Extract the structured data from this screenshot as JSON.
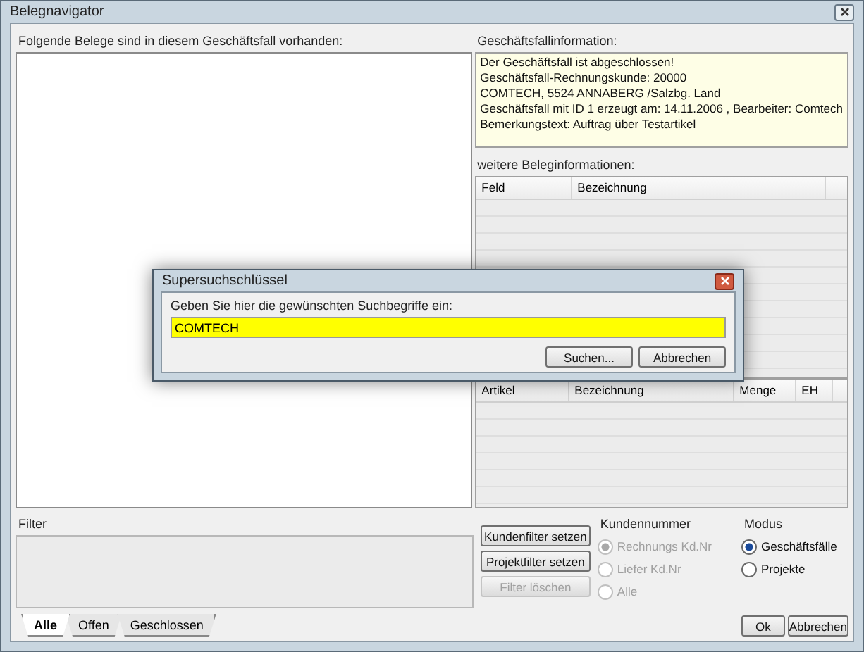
{
  "window": {
    "title": "Belegnavigator"
  },
  "documents_panel": {
    "label": "Folgende Belege sind in diesem Geschäftsfall vorhanden:"
  },
  "case_info": {
    "label": "Geschäftsfallinformation:",
    "lines": [
      "Der Geschäftsfall ist abgeschlossen!",
      "Geschäftsfall-Rechnungskunde: 20000",
      "COMTECH, 5524 ANNABERG /Salzbg. Land",
      "Geschäftsfall mit ID 1 erzeugt am: 14.11.2006 , Bearbeiter: Comtech",
      "Bemerkungstext: Auftrag über Testartikel"
    ]
  },
  "more_info": {
    "label": "weitere Beleginformationen:",
    "columns": [
      "Feld",
      "Bezeichnung"
    ]
  },
  "items_table": {
    "columns": [
      "Artikel",
      "Bezeichnung",
      "Menge",
      "EH"
    ]
  },
  "filter": {
    "label": "Filter"
  },
  "filter_buttons": [
    {
      "label": "Kundenfilter setzen",
      "disabled": false
    },
    {
      "label": "Projektfilter setzen",
      "disabled": false
    },
    {
      "label": "Filter löschen",
      "disabled": true
    }
  ],
  "customer_number": {
    "label": "Kundennummer",
    "options": [
      {
        "label": "Rechnungs Kd.Nr",
        "selected": true,
        "disabled": true
      },
      {
        "label": "Liefer Kd.Nr",
        "selected": false,
        "disabled": true
      },
      {
        "label": "Alle",
        "selected": false,
        "disabled": true
      }
    ]
  },
  "mode": {
    "label": "Modus",
    "options": [
      {
        "label": "Geschäftsfälle",
        "selected": true,
        "disabled": false
      },
      {
        "label": "Projekte",
        "selected": false,
        "disabled": false
      }
    ]
  },
  "tabs": [
    {
      "label": "Alle",
      "selected": true
    },
    {
      "label": "Offen",
      "selected": false
    },
    {
      "label": "Geschlossen",
      "selected": false
    }
  ],
  "buttons": [
    "Ok",
    "Abbrechen"
  ],
  "dialog": {
    "title": "Supersuchschlüssel",
    "prompt": "Geben Sie hier die gewünschten Suchbegriffe ein:",
    "value": "COMTECH",
    "buttons": [
      "Suchen...",
      "Abbrechen"
    ]
  }
}
